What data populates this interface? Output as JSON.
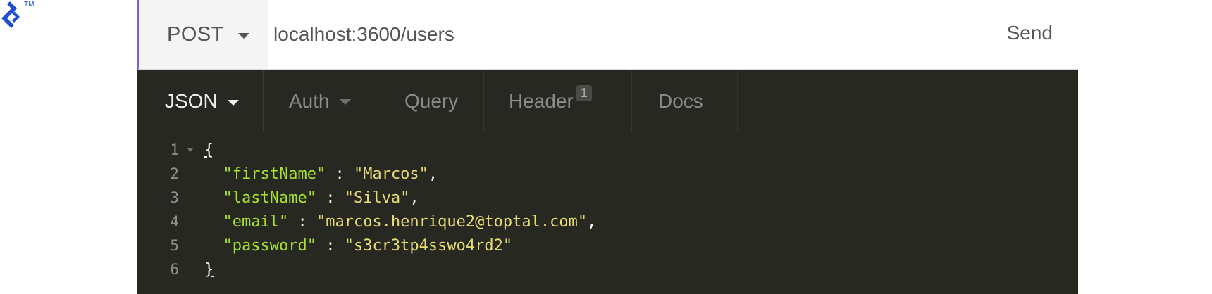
{
  "brand": {
    "trademark": "TM",
    "accent_color": "#204ecf",
    "icon": "toptal-logo-icon"
  },
  "request": {
    "method": "POST",
    "url": "localhost:3600/users",
    "send_label": "Send"
  },
  "tabs": [
    {
      "label": "JSON",
      "active": true,
      "has_dropdown": true
    },
    {
      "label": "Auth",
      "active": false,
      "has_dropdown": true
    },
    {
      "label": "Query",
      "active": false
    },
    {
      "label": "Header",
      "active": false,
      "badge": "1"
    },
    {
      "label": "Docs",
      "active": false
    }
  ],
  "editor": {
    "line_numbers": [
      "1",
      "2",
      "3",
      "4",
      "5",
      "6"
    ],
    "open_brace": "{",
    "close_brace": "}",
    "fields": [
      {
        "key": "\"firstName\"",
        "value": "\"Marcos\"",
        "trailing": ","
      },
      {
        "key": "\"lastName\"",
        "value": "\"Silva\"",
        "trailing": ","
      },
      {
        "key": "\"email\"",
        "value": "\"marcos.henrique2@toptal.com\"",
        "trailing": ","
      },
      {
        "key": "\"password\"",
        "value": "\"s3cr3tp4sswo4rd2\"",
        "trailing": ""
      }
    ],
    "separator": " : "
  },
  "colors": {
    "editor_bg": "#272822",
    "key_color": "#a6e22e",
    "string_color": "#e6db74",
    "method_bg": "#f4f4f4",
    "urlbar_accent": "#7a5fe0"
  }
}
